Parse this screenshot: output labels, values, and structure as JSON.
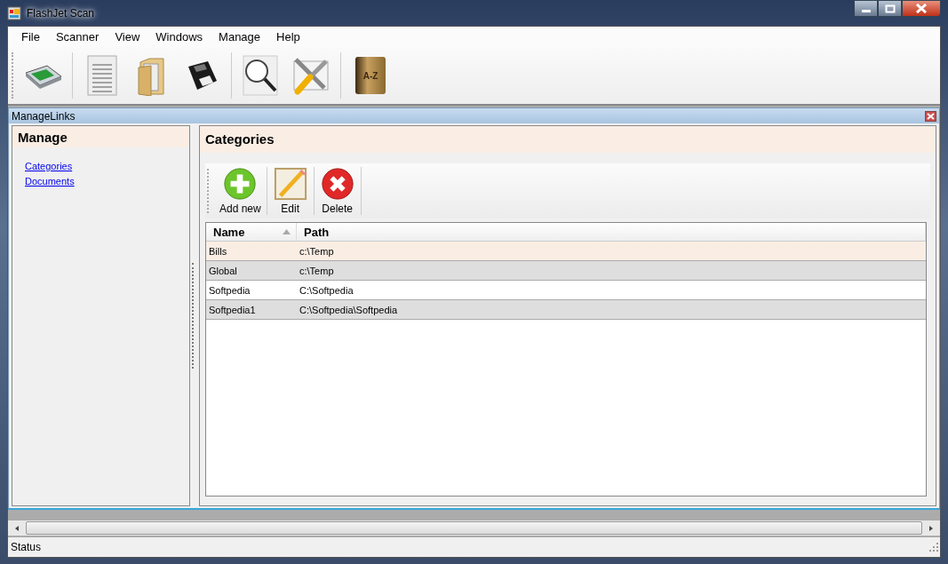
{
  "window": {
    "title": "FlashJet Scan"
  },
  "menu": [
    "File",
    "Scanner",
    "View",
    "Windows",
    "Manage",
    "Help"
  ],
  "toolbar": [
    {
      "kind": "scanner"
    },
    {
      "kind": "document"
    },
    {
      "kind": "folder"
    },
    {
      "kind": "floppy"
    },
    {
      "kind": "magnifier"
    },
    {
      "kind": "tools"
    },
    {
      "kind": "book",
      "label": "A-Z"
    }
  ],
  "child_window": {
    "title": "ManageLinks"
  },
  "sidebar": {
    "title": "Manage",
    "links": [
      "Categories",
      "Documents"
    ]
  },
  "content": {
    "title": "Categories",
    "actions": [
      {
        "kind": "add",
        "label": "Add new"
      },
      {
        "kind": "edit",
        "label": "Edit"
      },
      {
        "kind": "delete",
        "label": "Delete"
      }
    ],
    "table": {
      "columns": [
        {
          "label": "Name",
          "sorted": true
        },
        {
          "label": "Path",
          "sorted": false
        }
      ],
      "rows": [
        {
          "cells": [
            "Bills",
            "c:\\Temp"
          ],
          "selected": true
        },
        {
          "cells": [
            "Global",
            "c:\\Temp"
          ],
          "selected": false
        },
        {
          "cells": [
            "Softpedia",
            "C:\\Softpedia"
          ],
          "selected": false
        },
        {
          "cells": [
            "Softpedia1",
            "C:\\Softpedia\\Softpedia"
          ],
          "selected": false
        }
      ]
    }
  },
  "status_bar": {
    "text": "Status"
  }
}
